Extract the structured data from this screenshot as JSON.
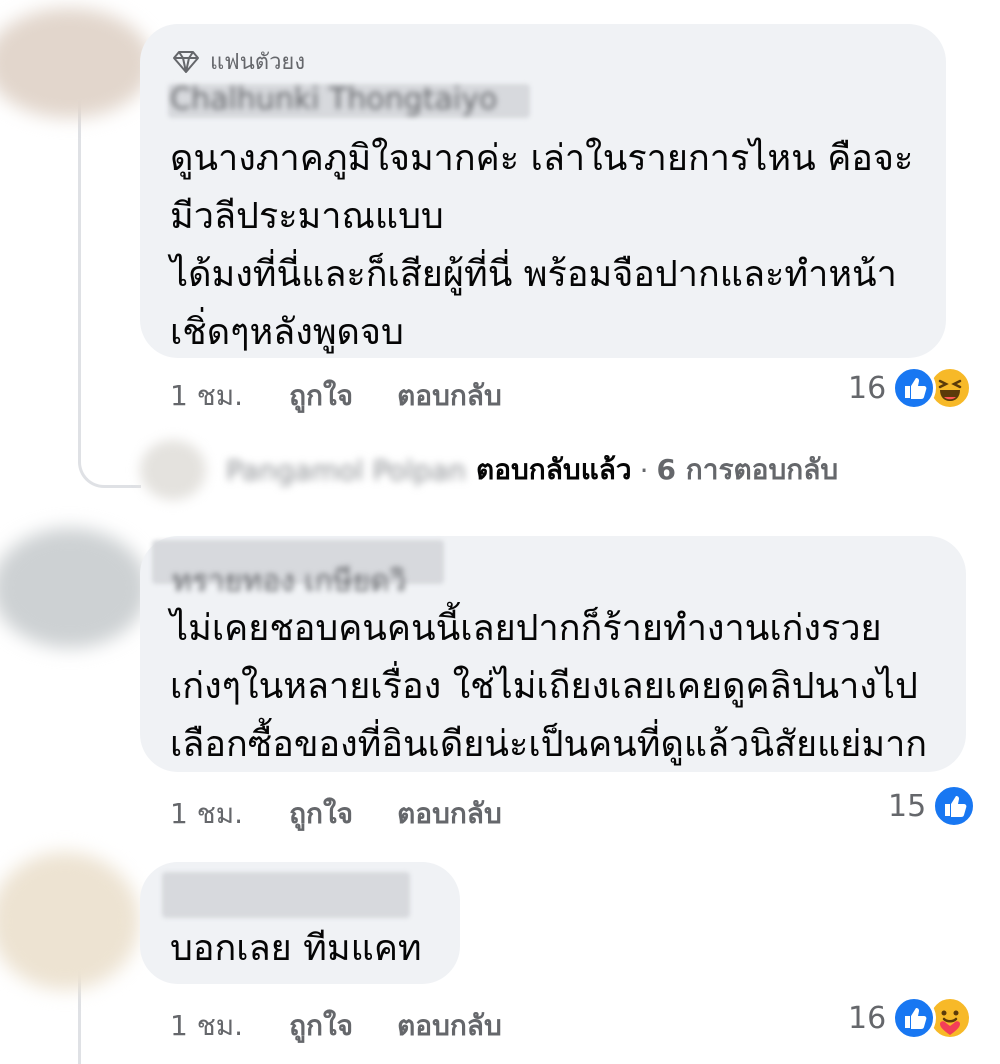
{
  "comments": [
    {
      "badge_label": "แฟนตัวยง",
      "author": "Chalhunki Thongtaiyo",
      "lines": [
        "ดูนางภาคภูมิใจมากค่ะ เล่าในรายการไหน คือจะ",
        "มีวลีประมาณแบบ",
        "ได้มงที่นี่และก็เสียผู้ที่นี่ พร้อมจือปากและทำหน้า",
        "เชิ่ดๆหลังพูดจบ"
      ],
      "time": "1 ชม.",
      "like_label": "ถูกใจ",
      "reply_label": "ตอบกลับ",
      "reaction_count": "16",
      "reactions": [
        "like-icon",
        "haha-icon"
      ],
      "replies": {
        "name": "Pangamol Polpan",
        "replied_label": "ตอบกลับแล้ว",
        "separator": "·",
        "count_label": "6 การตอบกลับ"
      }
    },
    {
      "author": "ทรายทอง เกษียดวิ",
      "lines": [
        "ไม่เคยชอบคนคนนี้เลยปากก็ร้ายทำงานเก่งรวย",
        "เก่งๆในหลายเรื่อง ใช่ไม่เถียงเลยเคยดูคลิปนางไป",
        "เลือกซื้อของที่อินเดียน่ะเป็นคนที่ดูแล้วนิสัยแย่มาก"
      ],
      "time": "1 ชม.",
      "like_label": "ถูกใจ",
      "reply_label": "ตอบกลับ",
      "reaction_count": "15",
      "reactions": [
        "like-icon"
      ]
    },
    {
      "author": "",
      "lines": [
        "บอกเลย ทีมแคท"
      ],
      "time": "1 ชม.",
      "like_label": "ถูกใจ",
      "reply_label": "ตอบกลับ",
      "reaction_count": "16",
      "reactions": [
        "like-icon",
        "care-icon"
      ]
    }
  ],
  "colors": {
    "bubble": "#f0f2f5",
    "meta_text": "#65676b",
    "like_blue": "#1877f2",
    "reaction_yellow": "#f7b928"
  }
}
